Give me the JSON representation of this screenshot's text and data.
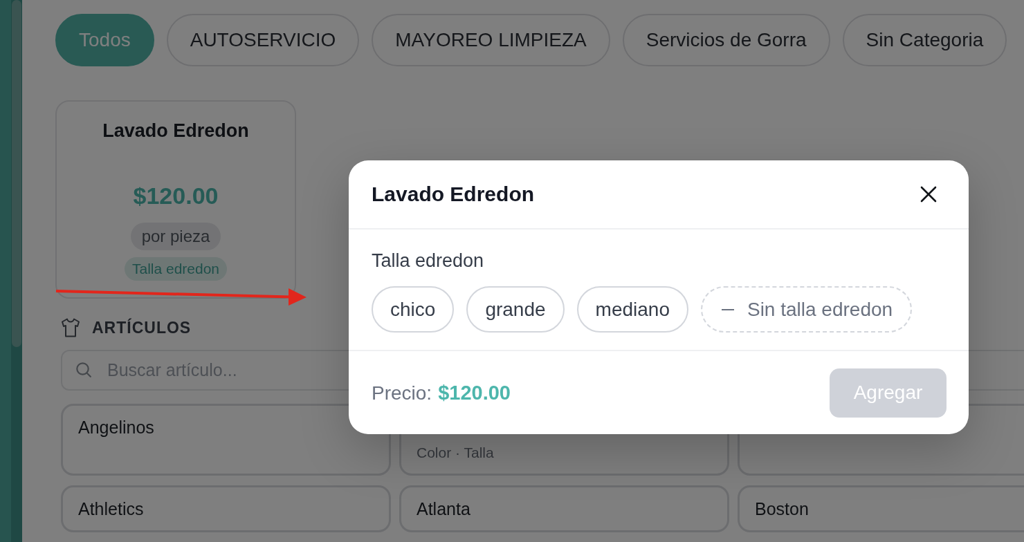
{
  "categories": [
    {
      "label": "Todos",
      "selected": true
    },
    {
      "label": "AUTOSERVICIO",
      "selected": false
    },
    {
      "label": "MAYOREO LIMPIEZA",
      "selected": false
    },
    {
      "label": "Servicios de Gorra",
      "selected": false
    },
    {
      "label": "Sin Categoria",
      "selected": false
    }
  ],
  "product_card": {
    "title": "Lavado Edredon",
    "price": "$120.00",
    "unit": "por pieza",
    "tag": "Talla edredon"
  },
  "articles": {
    "heading": "ARTÍCULOS",
    "search": {
      "placeholder": "Buscar artículo..."
    },
    "items": [
      {
        "kind": "article",
        "name": "Angelinos"
      },
      {
        "kind": "article",
        "details": "Color · Talla"
      },
      {
        "kind": "article"
      },
      {
        "kind": "article",
        "name": "Athletics"
      },
      {
        "kind": "article",
        "name": "Atlanta"
      },
      {
        "kind": "article",
        "name": "Boston"
      }
    ]
  },
  "modal": {
    "title": "Lavado Edredon",
    "group_label": "Talla edredon",
    "options": [
      {
        "label": "chico",
        "kind": "value",
        "selected": false
      },
      {
        "label": "grande",
        "kind": "value",
        "selected": false
      },
      {
        "label": "mediano",
        "kind": "value",
        "selected": false
      },
      {
        "label": "Sin talla edredon",
        "kind": "none",
        "selected": false
      }
    ],
    "price_label": "Precio:",
    "price": "$120.00",
    "add_button": {
      "label": "Agregar",
      "disabled": true
    }
  }
}
